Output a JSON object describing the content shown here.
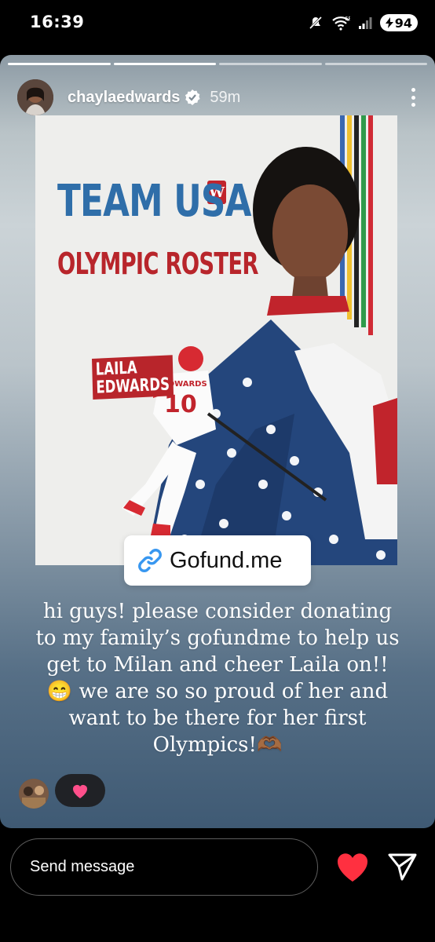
{
  "status_bar": {
    "time": "16:39",
    "network": "6E",
    "battery": "94"
  },
  "story": {
    "progress_segments": 4,
    "progress_current": 2,
    "username": "chaylaedwards",
    "posted_ago": "59m",
    "poster": {
      "title_line1": "TEAM USA",
      "title_line2": "OLYMPIC ROSTER",
      "player_first": "LAILA",
      "player_last": "EDWARDS",
      "jersey_name": "EDWARDS",
      "jersey_number": "10",
      "logo_letter": "W"
    },
    "link_sticker": "Gofund.me",
    "caption": "hi guys! please consider donating to my family’s gofundme to help us get to Milan and cheer Laila on!! 😁 we are so so proud of her and want to be there for her first Olympics!🫶🏾"
  },
  "bottom_bar": {
    "message_placeholder": "Send message"
  },
  "colors": {
    "accent_red": "#ff3040",
    "brand_red": "#c1242c",
    "poster_blue": "#2f6ea9"
  }
}
